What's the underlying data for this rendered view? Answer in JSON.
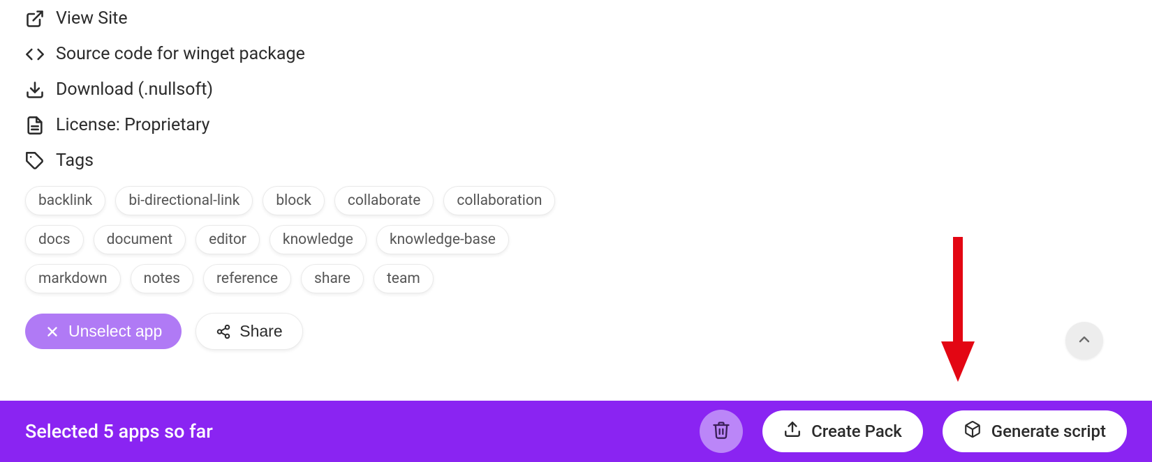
{
  "links": {
    "view_site": "View Site",
    "source_code": "Source code for winget package",
    "download": "Download (.nullsoft)",
    "license": "License: Proprietary",
    "tags_label": "Tags"
  },
  "tags": [
    "backlink",
    "bi-directional-link",
    "block",
    "collaborate",
    "collaboration",
    "docs",
    "document",
    "editor",
    "knowledge",
    "knowledge-base",
    "markdown",
    "notes",
    "reference",
    "share",
    "team"
  ],
  "actions": {
    "unselect": "Unselect app",
    "share": "Share"
  },
  "bottom": {
    "status": "Selected 5 apps so far",
    "create_pack": "Create Pack",
    "generate_script": "Generate script"
  },
  "colors": {
    "accent": "#8a24f2",
    "accent_light": "#b07af5"
  }
}
